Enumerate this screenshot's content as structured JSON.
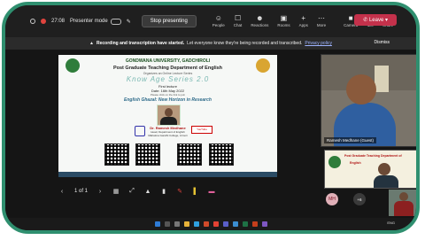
{
  "toolbar": {
    "timer": "27:08",
    "presenter_mode": "Presenter mode",
    "stop_presenting": "Stop presenting",
    "icons": [
      {
        "icon": "people-icon",
        "label": "People"
      },
      {
        "icon": "chat-icon",
        "label": "Chat"
      },
      {
        "icon": "reactions-icon",
        "label": "Reactions"
      },
      {
        "icon": "rooms-icon",
        "label": "Rooms"
      },
      {
        "icon": "apps-icon",
        "label": "Apps"
      },
      {
        "icon": "more-icon",
        "label": "More"
      },
      {
        "icon": "camera-icon",
        "label": "Camera"
      },
      {
        "icon": "mic-icon",
        "label": "Mic"
      },
      {
        "icon": "share-icon",
        "label": "Share"
      }
    ],
    "leave": "Leave"
  },
  "banner": {
    "bold": "Recording and transcription have started.",
    "text": "Let everyone know they're being recorded and transcribed.",
    "link": "Privacy policy",
    "dismiss": "Dismiss"
  },
  "slide": {
    "university": "GONDWANA UNIVERSITY, GADCHIROLI",
    "department": "Post Graduate Teaching Department of English",
    "organizes": "Organizes an Online Lecture Series",
    "series": "Know Age Series 2.0",
    "first_lecture": "First lecture",
    "date": "Date: 16th May 2022",
    "time": "Please click on the link to join",
    "topic": "English Ghazal: New Horizon in Research",
    "speaker_name": "Dr. Ramesh Medhane",
    "speaker_role": "Head, Department of English",
    "speaker_college": "Mahatma Gandhi College, Armori",
    "youtube": "YouTube"
  },
  "controls": {
    "page": "1 of 1"
  },
  "participants": {
    "main_name": "Ramesh Medhane (Guest)",
    "shared_t1": "Post Graduate Teaching Department of",
    "shared_t2": "English",
    "avatar_initials": "MH",
    "more_count": "+6"
  },
  "tray": {
    "lang": "ENG"
  },
  "colors": {
    "frame": "#2f8f6f",
    "leave": "#c4314b",
    "toolbar": "#1f1f1f"
  }
}
